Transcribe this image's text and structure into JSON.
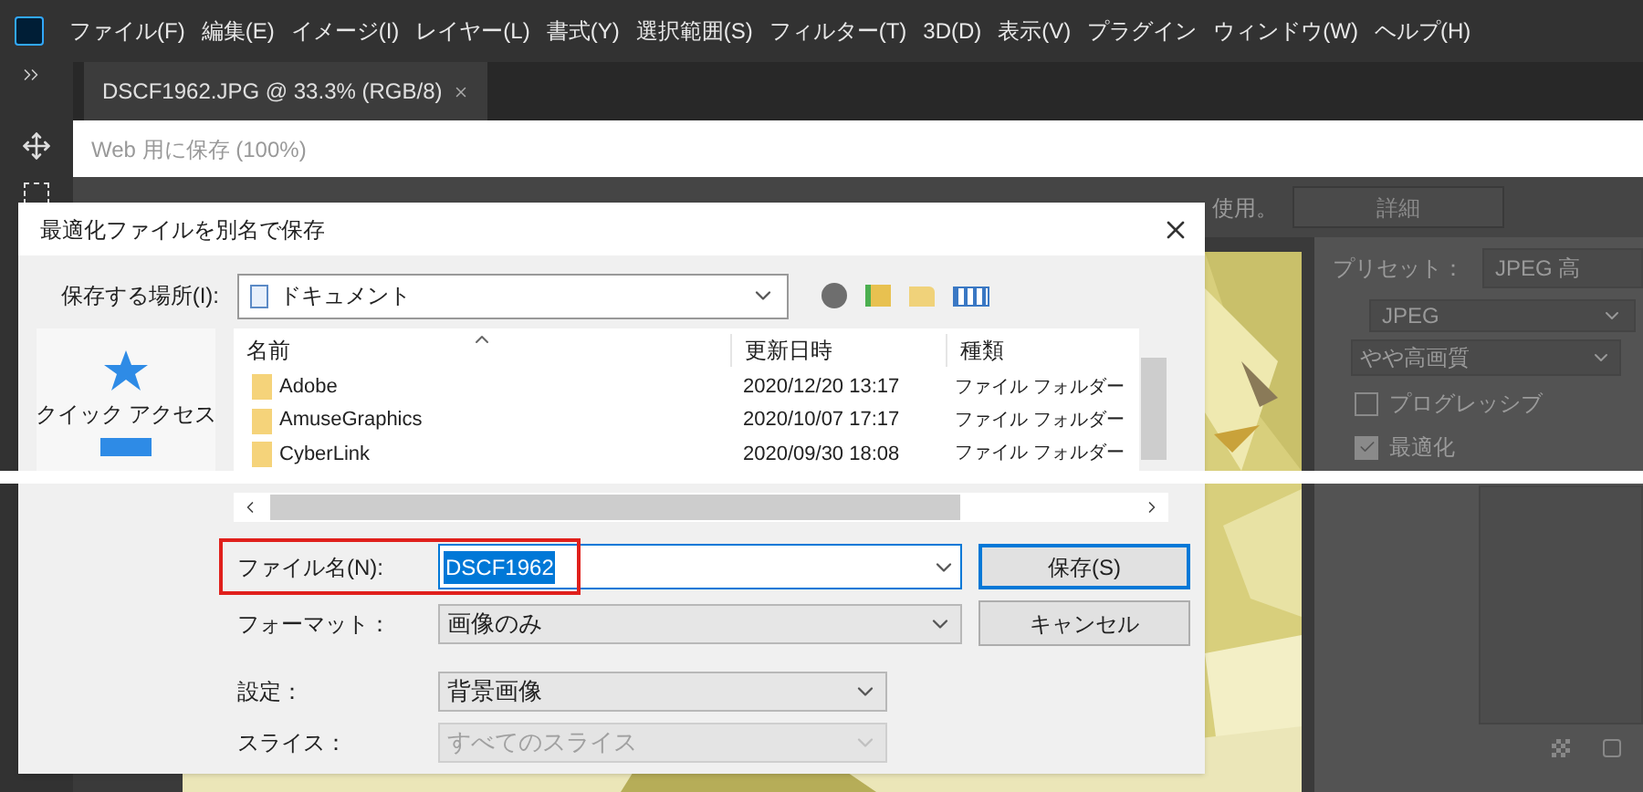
{
  "menu": [
    "ファイル(F)",
    "編集(E)",
    "イメージ(I)",
    "レイヤー(L)",
    "書式(Y)",
    "選択範囲(S)",
    "フィルター(T)",
    "3D(D)",
    "表示(V)",
    "プラグイン",
    "ウィンドウ(W)",
    "ヘルプ(H)"
  ],
  "document_tab": {
    "title": "DSCF1962.JPG @ 33.3% (RGB/8)"
  },
  "save_for_web": {
    "title": "Web 用に保存 (100%)",
    "hint_tail": "使用。",
    "details_button": "詳細",
    "settings": {
      "preset_label": "プリセット：",
      "preset": "JPEG 高",
      "format": "JPEG",
      "quality": "やや高画質",
      "options": [
        {
          "label": "プログレッシブ",
          "checked": false
        },
        {
          "label": "最適化",
          "checked": true
        }
      ]
    }
  },
  "dialog": {
    "title": "最適化ファイルを別名で保存",
    "location_label": "保存する場所(I):",
    "location": "ドキュメント",
    "places": [
      {
        "label": "クイック アクセス"
      }
    ],
    "columns": [
      "名前",
      "更新日時",
      "種類"
    ],
    "rows": [
      {
        "name": "Adobe",
        "modified": "2020/12/20 13:17",
        "type": "ファイル フォルダー"
      },
      {
        "name": "AmuseGraphics",
        "modified": "2020/10/07 17:17",
        "type": "ファイル フォルダー"
      },
      {
        "name": "CyberLink",
        "modified": "2020/09/30 18:08",
        "type": "ファイル フォルダー"
      }
    ],
    "fields": [
      {
        "label": "ファイル名(N):",
        "value": "DSCF1962",
        "kind": "filename"
      },
      {
        "label": "フォーマット：",
        "value": "画像のみ",
        "kind": "select"
      },
      {
        "label": "設定：",
        "value": "背景画像",
        "kind": "select"
      },
      {
        "label": "スライス：",
        "value": "すべてのスライス",
        "kind": "select",
        "disabled": true
      }
    ],
    "buttons": [
      {
        "label": "保存(S)",
        "default": true
      },
      {
        "label": "キャンセル",
        "default": false
      }
    ]
  }
}
